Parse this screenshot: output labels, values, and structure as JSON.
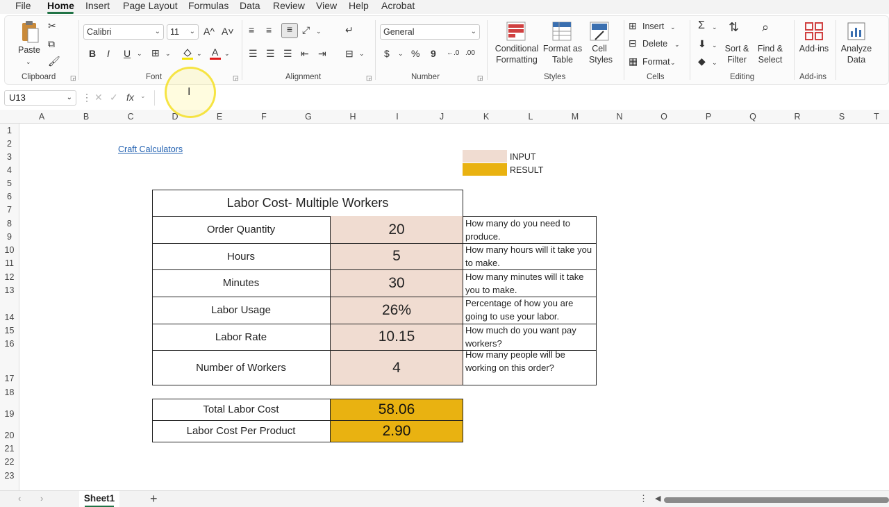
{
  "menu": {
    "items": [
      "File",
      "Home",
      "Insert",
      "Page Layout",
      "Formulas",
      "Data",
      "Review",
      "View",
      "Help",
      "Acrobat"
    ]
  },
  "ribbon": {
    "clipboard": {
      "paste": "Paste",
      "group": "Clipboard"
    },
    "font": {
      "name": "Calibri",
      "size": "11",
      "bold": "B",
      "italic": "I",
      "underline": "U",
      "grow": "A^",
      "shrink": "A˅",
      "group": "Font"
    },
    "alignment": {
      "group": "Alignment"
    },
    "number": {
      "format": "General",
      "currency": "$",
      "percent": "%",
      "comma": "9",
      "inc_decimal": "←.0",
      "dec_decimal": ".00",
      "group": "Number"
    },
    "styles": {
      "conditional1": "Conditional",
      "conditional2": "Formatting",
      "format_table1": "Format as",
      "format_table2": "Table",
      "cell_styles1": "Cell",
      "cell_styles2": "Styles",
      "group": "Styles"
    },
    "cells": {
      "insert": "Insert",
      "delete": "Delete",
      "format": "Format",
      "group": "Cells"
    },
    "editing": {
      "sort1": "Sort &",
      "sort2": "Filter",
      "find1": "Find &",
      "find2": "Select",
      "group": "Editing"
    },
    "addins": {
      "addins": "Add-ins",
      "group": "Add-ins"
    },
    "analyze": {
      "label1": "Analyze",
      "label2": "Data"
    }
  },
  "formula_bar": {
    "name_box": "U13",
    "fx": "fx",
    "value": ""
  },
  "columns": [
    "A",
    "B",
    "C",
    "D",
    "E",
    "F",
    "G",
    "H",
    "I",
    "J",
    "K",
    "L",
    "M",
    "N",
    "O",
    "P",
    "Q",
    "R",
    "S",
    "T"
  ],
  "rows": [
    "1",
    "2",
    "3",
    "4",
    "5",
    "6",
    "7",
    "8",
    "9",
    "10",
    "11",
    "12",
    "13",
    "14",
    "15",
    "16",
    "17",
    "18",
    "19",
    "20",
    "21",
    "22",
    "23"
  ],
  "sheet": {
    "link": "Craft Calculators",
    "legend": {
      "input": "INPUT",
      "result": "RESULT",
      "input_color": "#f0dcd1",
      "result_color": "#e9b211"
    },
    "title": "Labor Cost- Multiple Workers",
    "inputs": [
      {
        "label": "Order Quantity",
        "value": "20",
        "desc1": "How many do you need to",
        "desc2": "produce."
      },
      {
        "label": "Hours",
        "value": "5",
        "desc1": "How many hours will it take you",
        "desc2": "to make."
      },
      {
        "label": "Minutes",
        "value": "30",
        "desc1": "How many minutes will it take",
        "desc2": "you to make."
      },
      {
        "label": "Labor Usage",
        "value": "26%",
        "desc1": "Percentage of how you are",
        "desc2": "going to use your labor."
      },
      {
        "label": "Labor Rate",
        "value": "10.15",
        "desc1": "How much do you want pay",
        "desc2": "workers?"
      },
      {
        "label": "Number of Workers",
        "value": "4",
        "desc1": "How many people will be",
        "desc2": "working on this order?"
      }
    ],
    "results": [
      {
        "label": "Total Labor Cost",
        "value": "58.06"
      },
      {
        "label": "Labor Cost Per Product",
        "value": "2.90"
      }
    ]
  },
  "tabs": {
    "sheet1": "Sheet1",
    "add": "+"
  }
}
